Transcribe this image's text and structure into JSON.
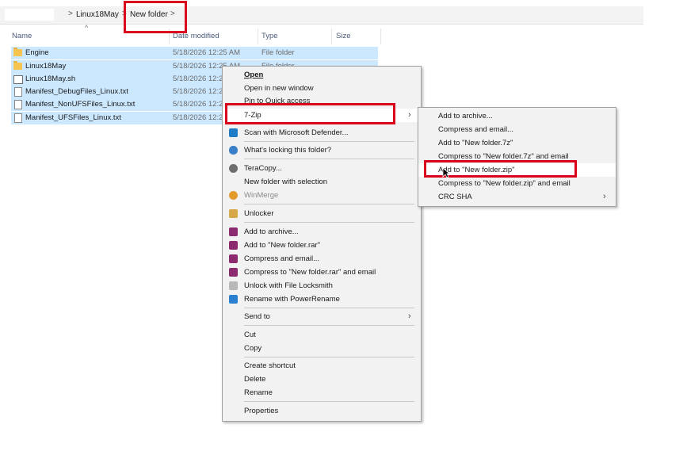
{
  "breadcrumb": {
    "items": [
      "Linux18May",
      "New folder"
    ],
    "separator": ">"
  },
  "columns": {
    "name": "Name",
    "date": "Date modified",
    "type": "Type",
    "size": "Size"
  },
  "files": [
    {
      "name": "Engine",
      "date": "5/18/2026 12:25 AM",
      "type": "File folder",
      "icon": "folder-icon"
    },
    {
      "name": "Linux18May",
      "date": "5/18/2026 12:25 AM",
      "type": "File folder",
      "icon": "folder-icon"
    },
    {
      "name": "Linux18May.sh",
      "date": "5/18/2026 12:24",
      "type": "",
      "icon": "script-file-icon"
    },
    {
      "name": "Manifest_DebugFiles_Linux.txt",
      "date": "5/18/2026 12:24",
      "type": "",
      "icon": "text-file-icon"
    },
    {
      "name": "Manifest_NonUFSFiles_Linux.txt",
      "date": "5/18/2026 12:24",
      "type": "",
      "icon": "text-file-icon"
    },
    {
      "name": "Manifest_UFSFiles_Linux.txt",
      "date": "5/18/2026 12:24",
      "type": "",
      "icon": "text-file-icon"
    }
  ],
  "context_menu": {
    "items": {
      "open": "Open",
      "open_new_window": "Open in new window",
      "pin_quick_access": "Pin to Quick access",
      "seven_zip": "7-Zip",
      "defender": "Scan with Microsoft Defender...",
      "whats_locking": "What's locking this folder?",
      "teracopy": "TeraCopy...",
      "new_folder_selection": "New folder with selection",
      "winmerge": "WinMerge",
      "unlocker": "Unlocker",
      "add_archive": "Add to archive...",
      "add_rar": "Add to \"New folder.rar\"",
      "compress_email": "Compress and email...",
      "compress_rar_email": "Compress to \"New folder.rar\" and email",
      "locksmith": "Unlock with File Locksmith",
      "powerrename": "Rename with PowerRename",
      "send_to": "Send to",
      "cut": "Cut",
      "copy": "Copy",
      "create_shortcut": "Create shortcut",
      "delete": "Delete",
      "rename": "Rename",
      "properties": "Properties"
    }
  },
  "submenu_7zip": {
    "items": [
      "Add to archive...",
      "Compress and email...",
      "Add to \"New folder.7z\"",
      "Compress to \"New folder.7z\" and email",
      "Add to \"New folder.zip\"",
      "Compress to \"New folder.zip\" and email",
      "CRC SHA"
    ],
    "highlighted_index": 4
  },
  "colors": {
    "selection": "#cce8ff",
    "highlight_box": "#d9001b",
    "menu_bg": "#f2f2f2"
  }
}
